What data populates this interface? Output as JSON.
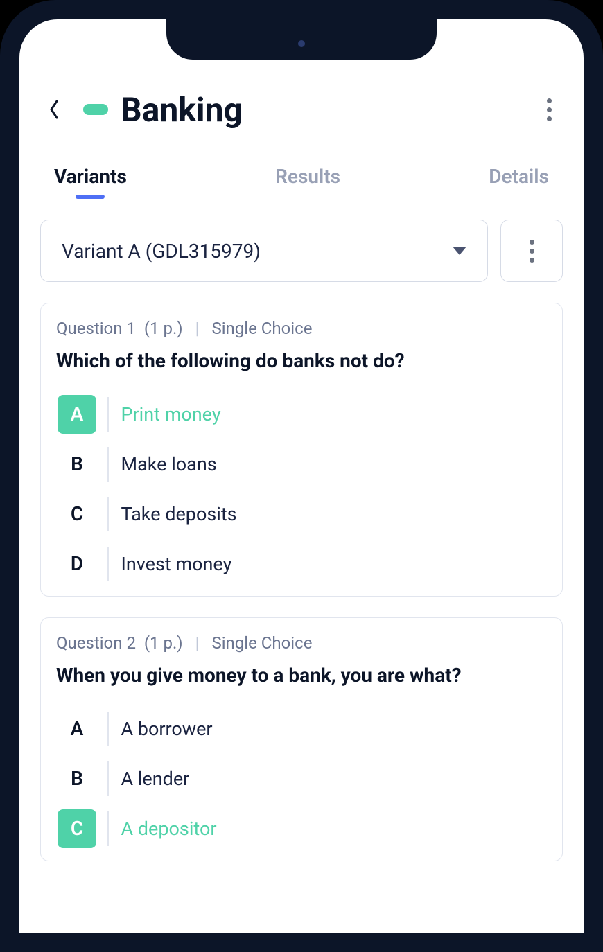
{
  "header": {
    "title": "Banking"
  },
  "tabs": [
    {
      "label": "Variants",
      "active": true
    },
    {
      "label": "Results",
      "active": false
    },
    {
      "label": "Details",
      "active": false
    }
  ],
  "variant_selector": {
    "selected": "Variant A (GDL315979)"
  },
  "questions": [
    {
      "number_label": "Question 1",
      "points_label": "(1 p.)",
      "type_label": "Single Choice",
      "prompt": "Which of the following do banks not do?",
      "options": [
        {
          "letter": "A",
          "text": "Print money",
          "correct": true
        },
        {
          "letter": "B",
          "text": "Make loans",
          "correct": false
        },
        {
          "letter": "C",
          "text": "Take deposits",
          "correct": false
        },
        {
          "letter": "D",
          "text": "Invest money",
          "correct": false
        }
      ]
    },
    {
      "number_label": "Question 2",
      "points_label": "(1 p.)",
      "type_label": "Single Choice",
      "prompt": "When you give money to a bank, you are what?",
      "options": [
        {
          "letter": "A",
          "text": "A borrower",
          "correct": false
        },
        {
          "letter": "B",
          "text": "A lender",
          "correct": false
        },
        {
          "letter": "C",
          "text": "A depositor",
          "correct": true
        }
      ]
    }
  ]
}
